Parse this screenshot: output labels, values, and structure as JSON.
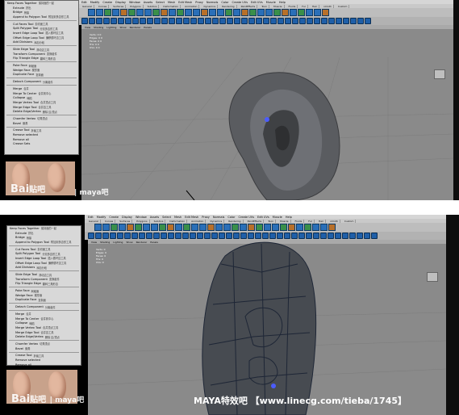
{
  "app": {
    "name": "Maya"
  },
  "main_menu": [
    "Edit",
    "Modify",
    "Create",
    "Display",
    "Window",
    "Assets",
    "Select",
    "Mesh",
    "Edit Mesh",
    "Proxy",
    "Normals",
    "Color",
    "Create UVs",
    "Edit UVs",
    "Muscle",
    "Help"
  ],
  "shelf_tabs": [
    "General",
    "Curves",
    "Surfaces",
    "Polygons",
    "Subdivs",
    "Deformation",
    "Animation",
    "Dynamics",
    "Rendering",
    "PaintEffects",
    "Toon",
    "Muscle",
    "Fluids",
    "Fur",
    "Hair",
    "nCloth",
    "Custom"
  ],
  "panel_menu": [
    "View",
    "Shading",
    "Lighting",
    "Show",
    "Renderer",
    "Panels"
  ],
  "hud": {
    "top": [
      "Verts: 0 0",
      "Edges: 0 0",
      "Faces: 0 0",
      "Tris: 0 0",
      "UVs: 0 0"
    ],
    "bottom": [
      "Verts: 0",
      "Edges: 0",
      "Faces: 0",
      "Tris: 0",
      "UVs: 0"
    ]
  },
  "poly_menu": {
    "header": "Keep Faces Together",
    "header_cn": "保持面的一起",
    "items": [
      {
        "en": "Extrude",
        "cn": "挤出"
      },
      {
        "en": "Bridge",
        "cn": "桥接"
      },
      {
        "en": "Append to Polygon Tool",
        "cn": "附加到多边形工具"
      },
      {
        "en": "Cut Faces Tool",
        "cn": "剪切面工具"
      },
      {
        "en": "Split Polygon Tool",
        "cn": "分割多边形工具"
      },
      {
        "en": "Insert Edge Loop Tool",
        "cn": "插入循环边工具"
      },
      {
        "en": "Offset Edge Loop Tool",
        "cn": "偏移循环边工具"
      },
      {
        "en": "Add Divisions",
        "cn": "添加分段"
      },
      {
        "en": "Slide Edge Tool",
        "cn": "滑动边工具"
      },
      {
        "en": "Transform Component",
        "cn": "变换组件"
      },
      {
        "en": "Flip Triangle Edge",
        "cn": "翻转三角形边"
      },
      {
        "en": "Poke Face",
        "cn": "刺破面"
      },
      {
        "en": "Wedge Face",
        "cn": "楔形面"
      },
      {
        "en": "Duplicate Face",
        "cn": "复制面"
      },
      {
        "en": "Detach Component",
        "cn": "分离组件"
      },
      {
        "en": "Merge",
        "cn": "合并"
      },
      {
        "en": "Merge To Center",
        "cn": "合并到中心"
      },
      {
        "en": "Collapse",
        "cn": "塌陷"
      },
      {
        "en": "Merge Vertex Tool",
        "cn": "合并顶点工具"
      },
      {
        "en": "Merge Edge Tool",
        "cn": "合并边工具"
      },
      {
        "en": "Delete Edge/Vertex",
        "cn": "删除 边/顶点"
      },
      {
        "en": "Chamfer Vertex",
        "cn": "切角顶点"
      },
      {
        "en": "Bevel",
        "cn": "倒角"
      },
      {
        "en": "Crease Tool",
        "cn": "折痕工具"
      },
      {
        "en": "Remove selected",
        "cn": ""
      },
      {
        "en": "Remove all",
        "cn": ""
      },
      {
        "en": "Crease Sets",
        "cn": ""
      }
    ]
  },
  "watermarks": {
    "baidu": "Bai",
    "tieba": "贴吧",
    "forum": "maya吧",
    "banner": "MAYA特效吧 【www.linecg.com/tieba/1745】"
  },
  "colors": {
    "viewport": "#8a8a8a",
    "mesh": "#4a4f55",
    "wire": "#2d3b52",
    "selection": "#4b5cff"
  }
}
